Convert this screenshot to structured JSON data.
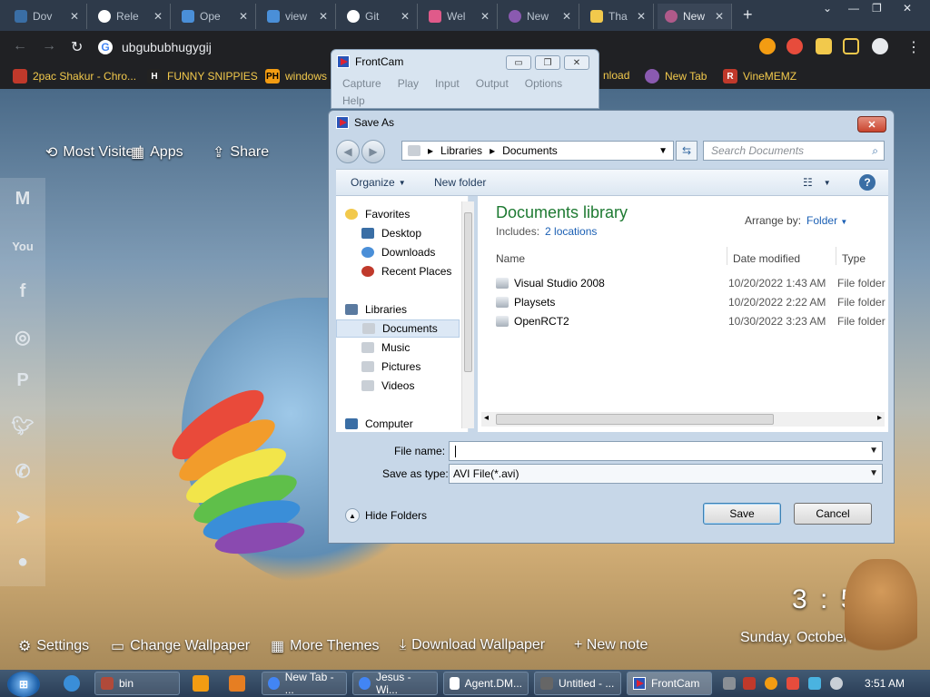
{
  "browser": {
    "tabs": [
      {
        "label": "Dov",
        "color": "#3a6ea5"
      },
      {
        "label": "Rele",
        "color": "#ffffff"
      },
      {
        "label": "Ope",
        "color": "#4a8fd8"
      },
      {
        "label": "view",
        "color": "#4a8fd8"
      },
      {
        "label": "Git",
        "color": "#ffffff"
      },
      {
        "label": "Wel",
        "color": "#e05a8a"
      },
      {
        "label": "New",
        "color": "#8a5ab0"
      },
      {
        "label": "Tha",
        "color": "#f2c94c"
      },
      {
        "label": "New",
        "color": "#b05a8a"
      }
    ],
    "new_tab": "+",
    "address": "ubgububhugygij",
    "bookmarks": [
      {
        "label": "2pac Shakur - Chro...",
        "icon": "2pac-icon",
        "color": "#c0392b"
      },
      {
        "label": "FUNNY SNIPPIES",
        "icon": "H",
        "color": "#222222"
      },
      {
        "label": "windows",
        "icon": "PH",
        "color": "#f39c12"
      },
      {
        "label": "nload",
        "icon": "",
        "color": "#3a6ea5"
      },
      {
        "label": "New Tab",
        "icon": "newtab-icon",
        "color": "#8a5ab0"
      },
      {
        "label": "VineMEMZ",
        "icon": "R",
        "color": "#c0392b"
      }
    ]
  },
  "newtab": {
    "most_visited": "Most Visited",
    "apps": "Apps",
    "share": "Share",
    "settings": "Settings",
    "change_wallpaper": "Change Wallpaper",
    "more_themes": "More Themes",
    "download_wallpaper": "Download Wallpaper",
    "new_note": "+ New note",
    "clock": "3 : 51",
    "date": "Sunday, October"
  },
  "frontcam": {
    "title": "FrontCam",
    "menu": [
      "Capture",
      "Play",
      "Input",
      "Output",
      "Options",
      "Help"
    ]
  },
  "dialog": {
    "title": "Save As",
    "breadcrumb": [
      "Libraries",
      "Documents"
    ],
    "search_placeholder": "Search Documents",
    "organize": "Organize",
    "new_folder": "New folder",
    "nav": {
      "favorites": "Favorites",
      "desktop": "Desktop",
      "downloads": "Downloads",
      "recent_places": "Recent Places",
      "libraries": "Libraries",
      "documents": "Documents",
      "music": "Music",
      "pictures": "Pictures",
      "videos": "Videos",
      "computer": "Computer"
    },
    "library_title": "Documents library",
    "includes_label": "Includes:",
    "includes_link": "2 locations",
    "arrange_by": "Arrange by:",
    "arrange_value": "Folder",
    "columns": {
      "name": "Name",
      "date": "Date modified",
      "type": "Type"
    },
    "files": [
      {
        "name": "Visual Studio 2008",
        "date": "10/20/2022 1:43 AM",
        "type": "File folder"
      },
      {
        "name": "Playsets",
        "date": "10/20/2022 2:22 AM",
        "type": "File folder"
      },
      {
        "name": "OpenRCT2",
        "date": "10/30/2022 3:23 AM",
        "type": "File folder"
      }
    ],
    "file_name_label": "File name:",
    "file_name_value": "",
    "save_type_label": "Save as type:",
    "save_type_value": "AVI File(*.avi)",
    "hide_folders": "Hide Folders",
    "save": "Save",
    "cancel": "Cancel"
  },
  "taskbar": {
    "items": [
      {
        "label": "bin",
        "color": "#b04a3a"
      },
      {
        "label": "New Tab - ...",
        "color": "#4285f4"
      },
      {
        "label": "Jesus - Wi...",
        "color": "#4285f4"
      },
      {
        "label": "Agent.DM...",
        "color": "#ffffff"
      },
      {
        "label": "Untitled - ...",
        "color": "#666666"
      },
      {
        "label": "FrontCam",
        "color": "#2a55b8"
      }
    ],
    "clock": "3:51 AM"
  }
}
